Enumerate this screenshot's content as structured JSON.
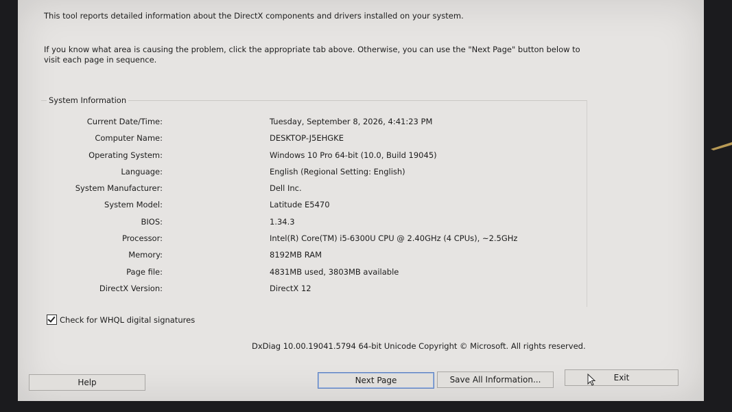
{
  "intro": {
    "line1": "This tool reports detailed information about the DirectX components and drivers installed on your system.",
    "line2": "If you know what area is causing the problem, click the appropriate tab above.  Otherwise, you can use the \"Next Page\" button below to visit each page in sequence."
  },
  "system_information": {
    "title": "System Information",
    "rows": [
      {
        "label": "Current Date/Time:",
        "value": "Tuesday, September 8, 2026, 4:41:23 PM"
      },
      {
        "label": "Computer Name:",
        "value": "DESKTOP-J5EHGKE"
      },
      {
        "label": "Operating System:",
        "value": "Windows 10 Pro 64-bit (10.0, Build 19045)"
      },
      {
        "label": "Language:",
        "value": "English (Regional Setting: English)"
      },
      {
        "label": "System Manufacturer:",
        "value": "Dell Inc."
      },
      {
        "label": "System Model:",
        "value": "Latitude E5470"
      },
      {
        "label": "BIOS:",
        "value": "1.34.3"
      },
      {
        "label": "Processor:",
        "value": "Intel(R) Core(TM) i5-6300U CPU @ 2.40GHz (4 CPUs), ~2.5GHz"
      },
      {
        "label": "Memory:",
        "value": "8192MB RAM"
      },
      {
        "label": "Page file:",
        "value": "4831MB used, 3803MB available"
      },
      {
        "label": "DirectX Version:",
        "value": "DirectX 12"
      }
    ]
  },
  "whql": {
    "label": "Check for WHQL digital signatures",
    "checked": true
  },
  "copyright": "DxDiag 10.00.19041.5794 64-bit Unicode  Copyright © Microsoft. All rights reserved.",
  "buttons": {
    "help": "Help",
    "next_page": "Next Page",
    "save_all": "Save All Information...",
    "exit": "Exit"
  }
}
